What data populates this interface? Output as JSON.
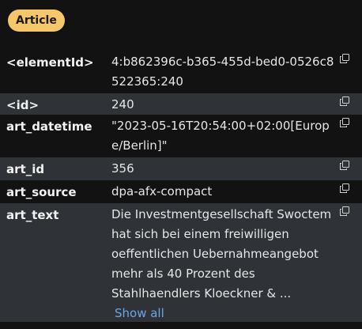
{
  "badge": {
    "label": "Article",
    "color": "#f5c66a"
  },
  "properties": [
    {
      "key": "<elementId>",
      "value": "4:b862396c-b365-455d-bed0-0526c8522365:240"
    },
    {
      "key": "<id>",
      "value": "240"
    },
    {
      "key": "art_datetime",
      "value": "\"2023-05-16T20:54:00+02:00[Europe/Berlin]\""
    },
    {
      "key": "art_id",
      "value": "356"
    },
    {
      "key": "art_source",
      "value": "dpa-afx-compact"
    },
    {
      "key": "art_text",
      "value": "Die Investmentgesellschaft Swoctem hat sich bei einem freiwilligen oeffentlichen Uebernahmeangebot mehr als 40 Prozent des Stahlhaendlers Kloeckner & ...",
      "show_all_label": "Show all"
    }
  ],
  "icons": {
    "copy": "copy-icon"
  }
}
